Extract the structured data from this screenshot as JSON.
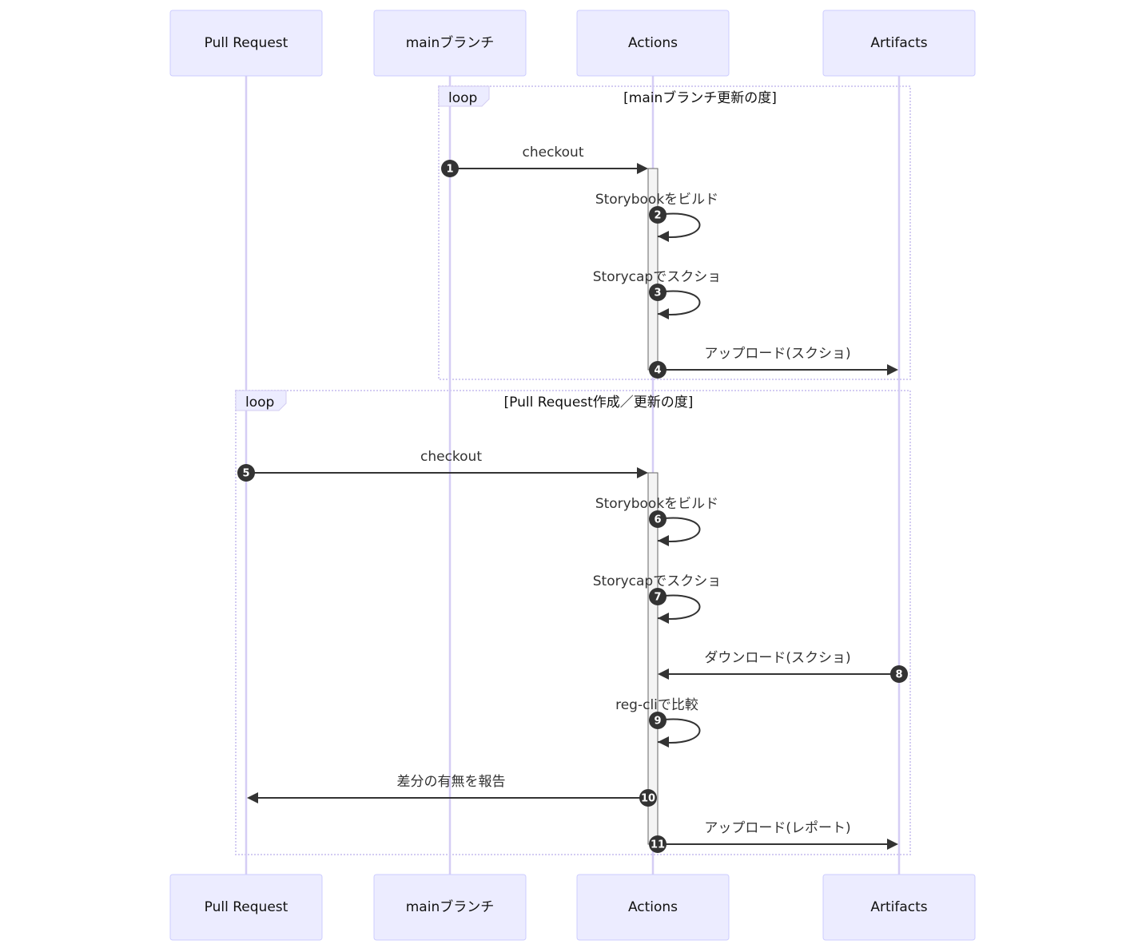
{
  "diagram": {
    "type": "sequence",
    "participants": [
      {
        "id": "pr",
        "label": "Pull Request"
      },
      {
        "id": "main",
        "label": "mainブランチ"
      },
      {
        "id": "actions",
        "label": "Actions"
      },
      {
        "id": "artifacts",
        "label": "Artifacts"
      }
    ],
    "loops": [
      {
        "tag": "loop",
        "condition": "[mainブランチ更新の度]"
      },
      {
        "tag": "loop",
        "condition": "[Pull Request作成／更新の度]"
      }
    ],
    "messages": [
      {
        "num": "1",
        "from": "main",
        "to": "actions",
        "text": "checkout"
      },
      {
        "num": "2",
        "from": "actions",
        "to": "actions",
        "text": "Storybookをビルド"
      },
      {
        "num": "3",
        "from": "actions",
        "to": "actions",
        "text": "Storycapでスクショ"
      },
      {
        "num": "4",
        "from": "actions",
        "to": "artifacts",
        "text": "アップロード(スクショ)"
      },
      {
        "num": "5",
        "from": "pr",
        "to": "actions",
        "text": "checkout"
      },
      {
        "num": "6",
        "from": "actions",
        "to": "actions",
        "text": "Storybookをビルド"
      },
      {
        "num": "7",
        "from": "actions",
        "to": "actions",
        "text": "Storycapでスクショ"
      },
      {
        "num": "8",
        "from": "artifacts",
        "to": "actions",
        "text": "ダウンロード(スクショ)"
      },
      {
        "num": "9",
        "from": "actions",
        "to": "actions",
        "text": "reg-cliで比較"
      },
      {
        "num": "10",
        "from": "actions",
        "to": "pr",
        "text": "差分の有無を報告"
      },
      {
        "num": "11",
        "from": "actions",
        "to": "artifacts",
        "text": "アップロード(レポート)"
      }
    ]
  }
}
